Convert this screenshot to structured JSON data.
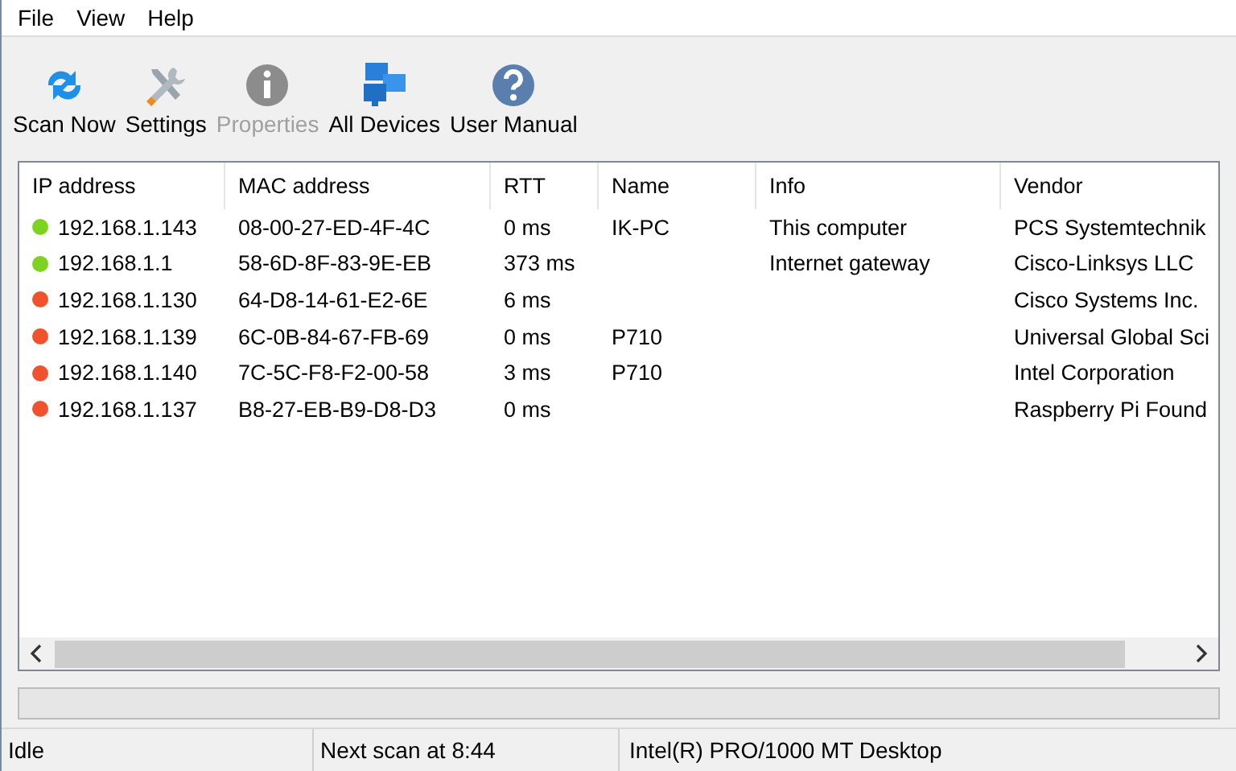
{
  "menu": [
    "File",
    "View",
    "Help"
  ],
  "toolbar": [
    {
      "label": "Scan Now",
      "kind": "scan",
      "disabled": false
    },
    {
      "label": "Settings",
      "kind": "settings",
      "disabled": false
    },
    {
      "label": "Properties",
      "kind": "info",
      "disabled": true
    },
    {
      "label": "All Devices",
      "kind": "devices",
      "disabled": false
    },
    {
      "label": "User Manual",
      "kind": "help",
      "disabled": false
    }
  ],
  "table": {
    "columns": [
      "IP address",
      "MAC address",
      "RTT",
      "Name",
      "Info",
      "Vendor"
    ],
    "rows": [
      {
        "color": "#7ed321",
        "cells": [
          "192.168.1.143",
          "08-00-27-ED-4F-4C",
          "0 ms",
          "IK-PC",
          "This computer",
          "PCS Systemtechnik"
        ]
      },
      {
        "color": "#7ed321",
        "cells": [
          "192.168.1.1",
          "58-6D-8F-83-9E-EB",
          "373 ms",
          "",
          "Internet gateway",
          "Cisco-Linksys LLC"
        ]
      },
      {
        "color": "#f0522e",
        "cells": [
          "192.168.1.130",
          "64-D8-14-61-E2-6E",
          "6 ms",
          "",
          "",
          "Cisco Systems Inc."
        ]
      },
      {
        "color": "#f0522e",
        "cells": [
          "192.168.1.139",
          "6C-0B-84-67-FB-69",
          "0 ms",
          "P710",
          "",
          "Universal Global Sci"
        ]
      },
      {
        "color": "#f0522e",
        "cells": [
          "192.168.1.140",
          "7C-5C-F8-F2-00-58",
          "3 ms",
          "P710",
          "",
          "Intel Corporation"
        ]
      },
      {
        "color": "#f0522e",
        "cells": [
          "192.168.1.137",
          "B8-27-EB-B9-D8-D3",
          "0 ms",
          "",
          "",
          "Raspberry Pi Found"
        ]
      }
    ]
  },
  "progress": {
    "level": 0
  },
  "status_bar": [
    "Idle",
    "Next scan at 8:44",
    "Intel(R) PRO/1000 MT Desktop"
  ]
}
